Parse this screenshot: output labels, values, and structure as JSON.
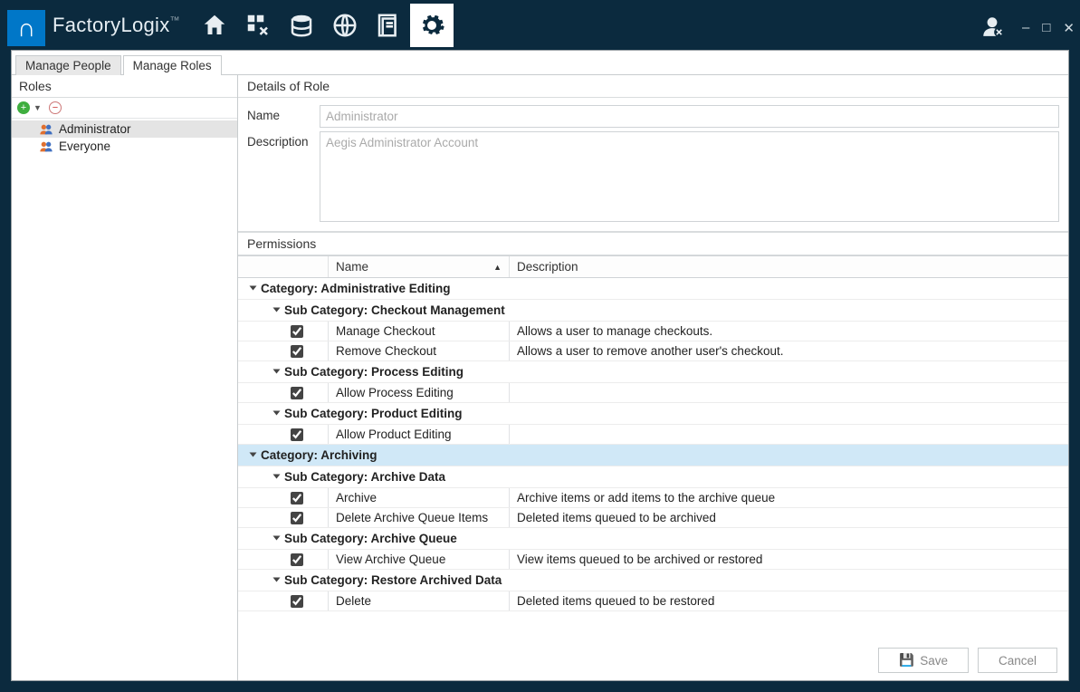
{
  "brand": {
    "part1": "Factory",
    "part2": "Logix"
  },
  "tabs": {
    "people": "Manage People",
    "roles": "Manage Roles"
  },
  "left": {
    "title": "Roles",
    "items": [
      "Administrator",
      "Everyone"
    ]
  },
  "details": {
    "title": "Details of Role",
    "name_label": "Name",
    "name_value": "Administrator",
    "desc_label": "Description",
    "desc_value": "Aegis Administrator Account"
  },
  "perm": {
    "title": "Permissions",
    "col_name": "Name",
    "col_desc": "Description"
  },
  "cats": [
    {
      "label": "Category: Administrative Editing",
      "subs": [
        {
          "label": "Sub Category: Checkout Management",
          "rows": [
            {
              "name": "Manage Checkout",
              "desc": "Allows a user to manage checkouts."
            },
            {
              "name": "Remove Checkout",
              "desc": "Allows a user to remove another user's checkout."
            }
          ]
        },
        {
          "label": "Sub Category: Process Editing",
          "rows": [
            {
              "name": "Allow Process Editing",
              "desc": ""
            }
          ]
        },
        {
          "label": "Sub Category: Product Editing",
          "rows": [
            {
              "name": "Allow Product Editing",
              "desc": ""
            }
          ]
        }
      ]
    },
    {
      "label": "Category: Archiving",
      "selected": true,
      "subs": [
        {
          "label": "Sub Category: Archive Data",
          "rows": [
            {
              "name": "Archive",
              "desc": "Archive items or add items to the archive queue"
            },
            {
              "name": "Delete Archive Queue Items",
              "desc": "Deleted items queued to be archived"
            }
          ]
        },
        {
          "label": "Sub Category: Archive Queue",
          "rows": [
            {
              "name": "View Archive Queue",
              "desc": "View items queued to be archived or restored"
            }
          ]
        },
        {
          "label": "Sub Category: Restore Archived Data",
          "rows": [
            {
              "name": "Delete",
              "desc": "Deleted items queued to be restored"
            }
          ]
        }
      ]
    }
  ],
  "footer": {
    "save": "Save",
    "cancel": "Cancel"
  }
}
